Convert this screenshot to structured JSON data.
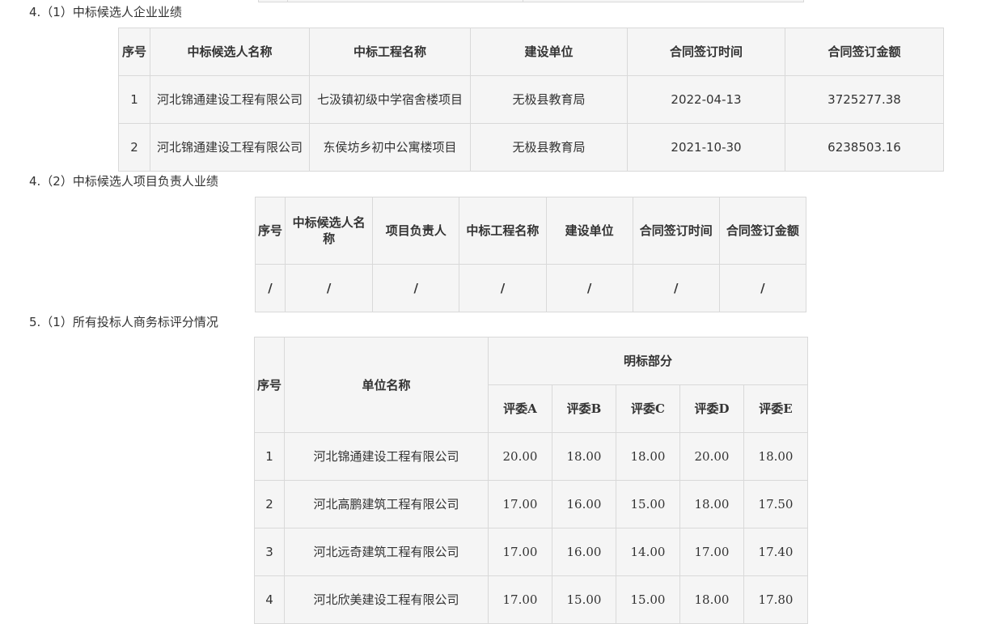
{
  "sections": {
    "s4_1": "4.（1）中标候选人企业业绩",
    "s4_2": "4.（2）中标候选人项目负责人业绩",
    "s5_1": "5.（1）所有投标人商务标评分情况"
  },
  "table1": {
    "headers": [
      "序号",
      "中标候选人名称",
      "中标工程名称",
      "建设单位",
      "合同签订时间",
      "合同签订金额"
    ],
    "rows": [
      [
        "1",
        "河北锦通建设工程有限公司",
        "七汲镇初级中学宿舍楼项目",
        "无极县教育局",
        "2022-04-13",
        "3725277.38"
      ],
      [
        "2",
        "河北锦通建设工程有限公司",
        "东侯坊乡初中公寓楼项目",
        "无极县教育局",
        "2021-10-30",
        "6238503.16"
      ]
    ]
  },
  "table2": {
    "headers": [
      "序号",
      "中标候选人名称",
      "项目负责人",
      "中标工程名称",
      "建设单位",
      "合同签订时间",
      "合同签订金额"
    ],
    "rows": [
      [
        "/",
        "/",
        "/",
        "/",
        "/",
        "/",
        "/"
      ]
    ]
  },
  "table3": {
    "header_seq": "序号",
    "header_name": "单位名称",
    "header_group": "明标部分",
    "judges": [
      "评委A",
      "评委B",
      "评委C",
      "评委D",
      "评委E"
    ],
    "rows": [
      [
        "1",
        "河北锦通建设工程有限公司",
        "20.00",
        "18.00",
        "18.00",
        "20.00",
        "18.00"
      ],
      [
        "2",
        "河北高鹏建筑工程有限公司",
        "17.00",
        "16.00",
        "15.00",
        "18.00",
        "17.50"
      ],
      [
        "3",
        "河北远奇建筑工程有限公司",
        "17.00",
        "16.00",
        "14.00",
        "17.00",
        "17.40"
      ],
      [
        "4",
        "河北欣美建设工程有限公司",
        "17.00",
        "15.00",
        "15.00",
        "18.00",
        "17.80"
      ]
    ]
  }
}
